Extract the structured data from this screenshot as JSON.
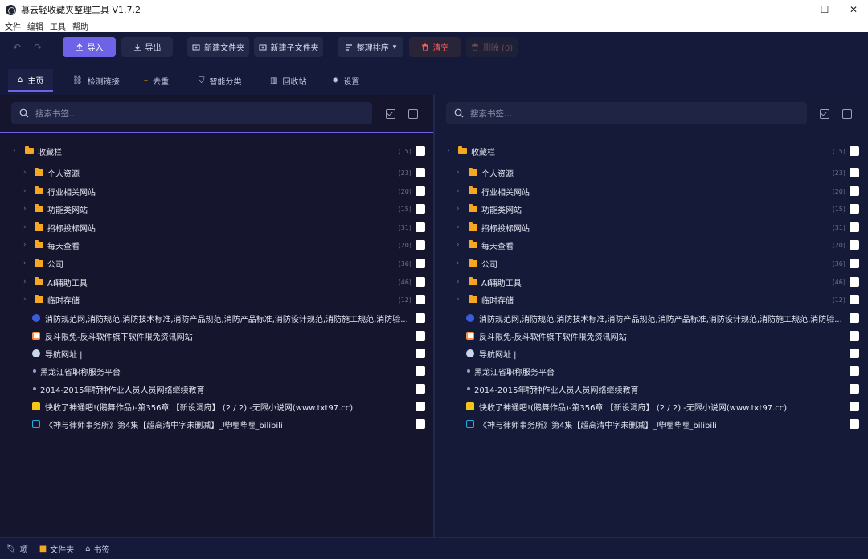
{
  "title": "慕云轻收藏夹整理工具 V1.7.2",
  "window_controls": {
    "minimize": "—",
    "maximize": "☐",
    "close": "✕"
  },
  "menu": [
    "文件",
    "编辑",
    "工具",
    "帮助"
  ],
  "toolbar": {
    "undo": "↶",
    "redo": "↷",
    "import": "导入",
    "export": "导出",
    "new_folder": "新建文件夹",
    "new_subfolder": "新建子文件夹",
    "sort": "整理排序",
    "sort_chevron": "▾",
    "clear": "清空",
    "delete": "删除 (0)"
  },
  "tabs": [
    {
      "label": "主页",
      "icon": "home-icon"
    },
    {
      "label": "检测链接",
      "icon": "link-icon"
    },
    {
      "label": "去重",
      "icon": "broom-icon"
    },
    {
      "label": "智能分类",
      "icon": "shield-icon"
    },
    {
      "label": "回收站",
      "icon": "trash-icon"
    },
    {
      "label": "设置",
      "icon": "gear-icon"
    }
  ],
  "search": {
    "placeholder": "搜索书签..."
  },
  "tree": {
    "root": {
      "label": "收藏栏",
      "count": "(15)"
    },
    "folders": [
      {
        "label": "个人资源",
        "count": "(23)"
      },
      {
        "label": "行业相关网站",
        "count": "(20)"
      },
      {
        "label": "功能类网站",
        "count": "(15)"
      },
      {
        "label": "招标投标网站",
        "count": "(31)"
      },
      {
        "label": "每天查看",
        "count": "(20)"
      },
      {
        "label": "公司",
        "count": "(36)"
      },
      {
        "label": "AI辅助工具",
        "count": "(46)"
      },
      {
        "label": "临时存储",
        "count": "(12)"
      }
    ],
    "bookmarks": [
      {
        "label": "消防规范网,消防规范,消防技术标准,消防产品规范,消防产品标准,消防设计规范,消防施工规范,消防验...",
        "icon": "globe-blue",
        "color": "#3b5bdb"
      },
      {
        "label": "反斗限免-反斗软件旗下软件限免资讯网站",
        "icon": "page-orange",
        "color": "#ff8c42"
      },
      {
        "label": "导航网址 |",
        "icon": "wordpress",
        "color": "#c9d6ec"
      },
      {
        "label": "黑龙江省职称服务平台",
        "icon": "dot",
        "color": "#9aa0bb"
      },
      {
        "label": "2014-2015年特种作业人员人员网络继续教育",
        "icon": "dot",
        "color": "#9aa0bb"
      },
      {
        "label": "快收了神通吧!(鹅舞作品)-第356章 【新设洞府】 (2 / 2) -无限小说网(www.txt97.cc)",
        "icon": "novel-yellow",
        "color": "#f5c518"
      },
      {
        "label": "《神与律师事务所》第4集【超高清中字未删减】_哔哩哔哩_bilibili",
        "icon": "bilibili",
        "color": "#23ade5"
      }
    ]
  },
  "status": [
    {
      "label": "项",
      "icon": "bookmark-icon"
    },
    {
      "label": "文件夹",
      "icon": "folder-icon"
    },
    {
      "label": "书签",
      "icon": "tag-icon"
    }
  ]
}
